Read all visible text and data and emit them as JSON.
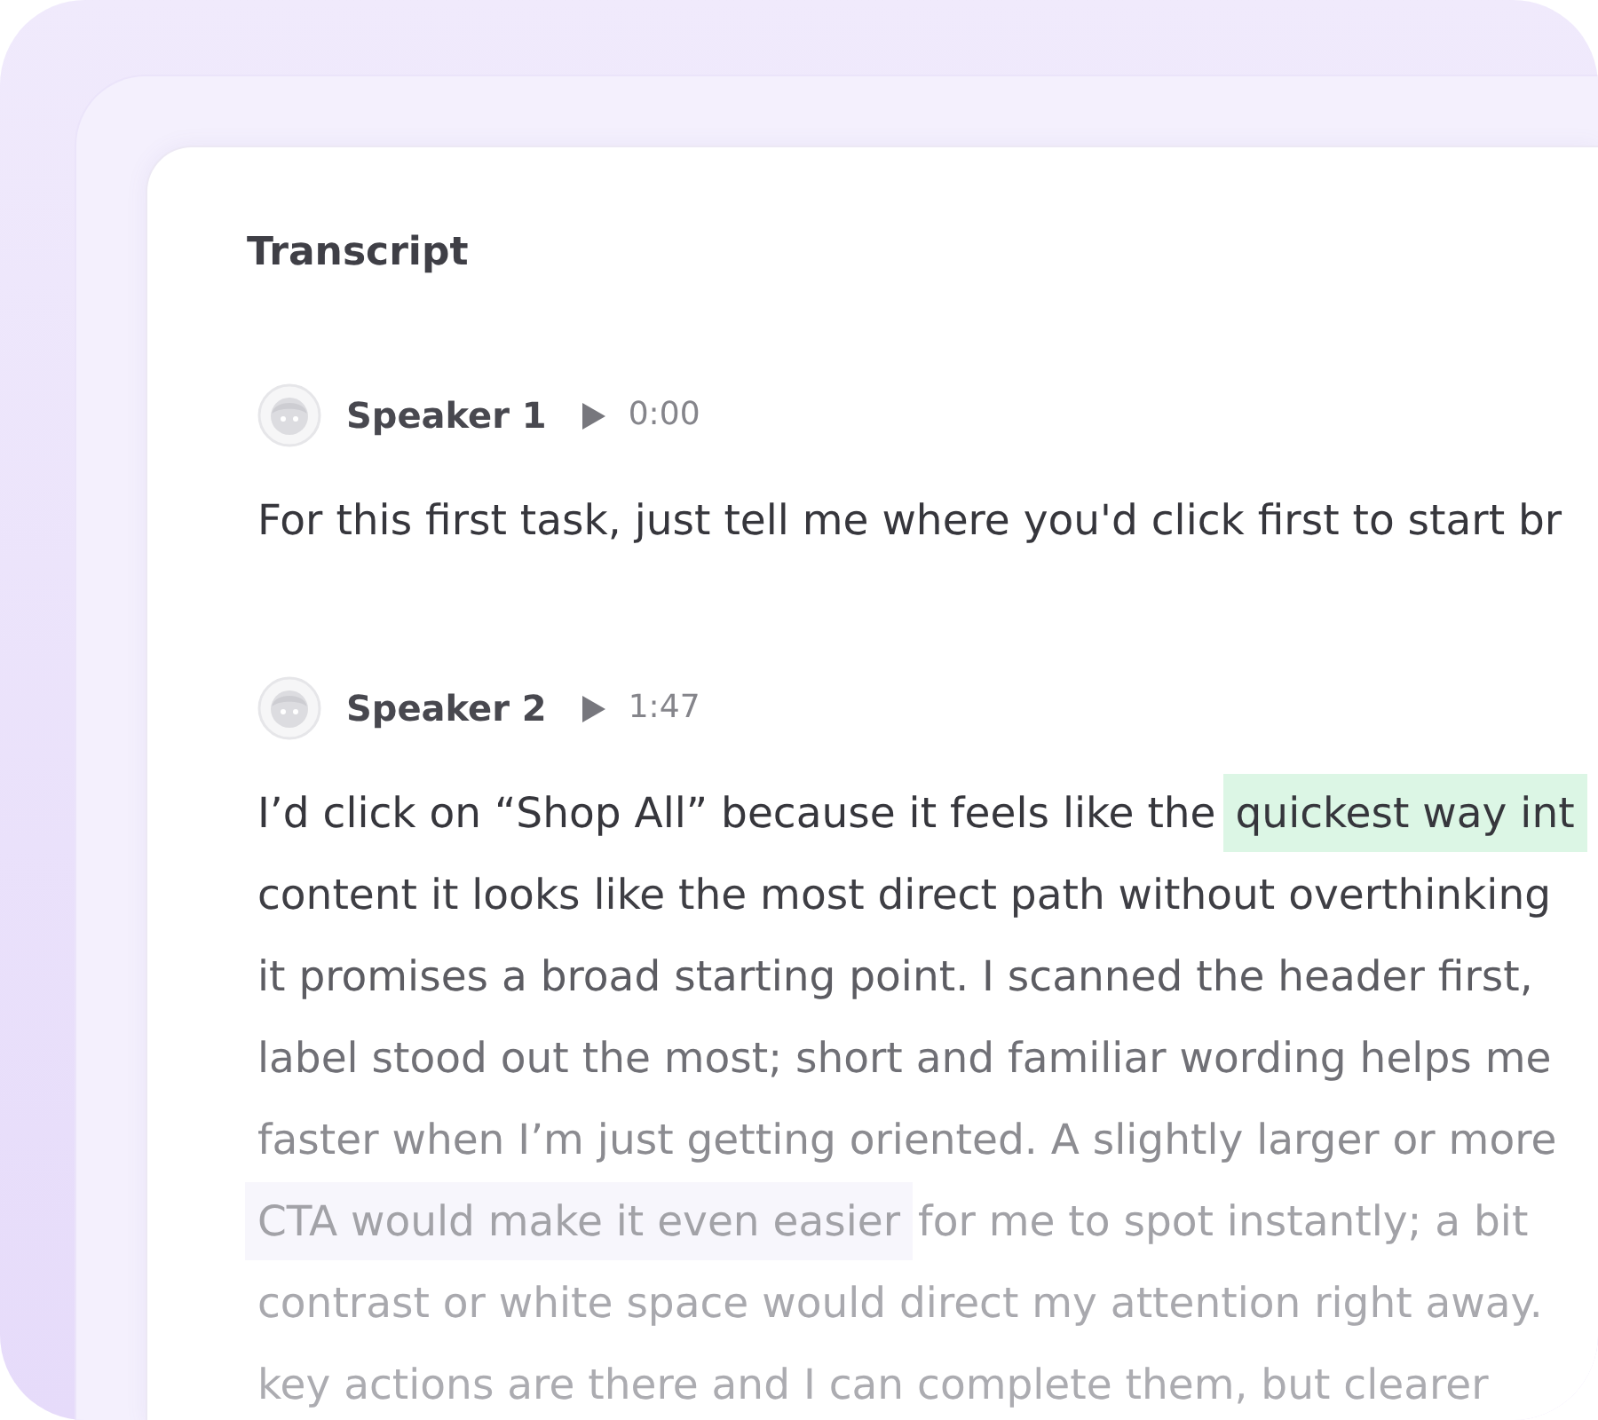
{
  "title": "Transcript",
  "entries": [
    {
      "speaker": "Speaker 1",
      "time": "0:00",
      "lines": [
        {
          "segments": [
            {
              "text": "For this first task, just tell me where you'd click first to start br"
            }
          ]
        }
      ]
    },
    {
      "speaker": "Speaker 2",
      "time": "1:47",
      "lines": [
        {
          "segments": [
            {
              "text": "I’d click on “Shop All” because it feels like the"
            },
            {
              "text": "quickest way int",
              "color": "#dcf6e5"
            }
          ]
        },
        {
          "segments": [
            {
              "text": "content it looks like the most direct path without overthinking"
            }
          ]
        },
        {
          "segments": [
            {
              "text": "it promises a broad starting point. I scanned the header first,"
            }
          ]
        },
        {
          "segments": [
            {
              "text": "label stood out the most; short and familiar wording helps me"
            }
          ]
        },
        {
          "segments": [
            {
              "text": "faster when I’m just getting oriented. A slightly larger or more"
            }
          ]
        },
        {
          "segments": [
            {
              "text": "CTA would make it even easier",
              "color": "#f7f6fc"
            },
            {
              "text": "for me to spot instantly; a bit"
            }
          ]
        },
        {
          "segments": [
            {
              "text": "contrast or white space would direct my attention right away."
            }
          ]
        },
        {
          "segments": [
            {
              "text": "key actions are there and I can complete them, but clearer"
            }
          ]
        }
      ]
    }
  ]
}
